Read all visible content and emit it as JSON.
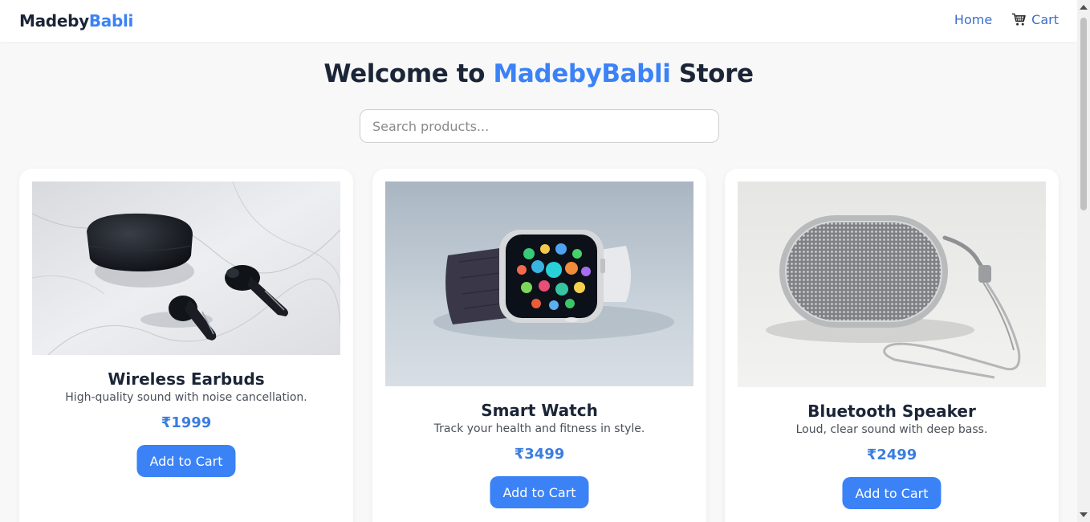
{
  "nav": {
    "logo_main": "Madeby",
    "logo_accent": "Babli",
    "home_label": "Home",
    "cart_label": "Cart"
  },
  "hero": {
    "title_start": "Welcome to ",
    "title_accent": "MadebyBabli",
    "title_end": " Store"
  },
  "search": {
    "placeholder": "Search products...",
    "value": ""
  },
  "products": [
    {
      "name": "Wireless Earbuds",
      "description": "High-quality sound with noise cancellation.",
      "price": "₹1999",
      "button": "Add to Cart",
      "image_icon": "earbuds-image"
    },
    {
      "name": "Smart Watch",
      "description": "Track your health and fitness in style.",
      "price": "₹3499",
      "button": "Add to Cart",
      "image_icon": "smart-watch-image"
    },
    {
      "name": "Bluetooth Speaker",
      "description": "Loud, clear sound with deep bass.",
      "price": "₹2499",
      "button": "Add to Cart",
      "image_icon": "bluetooth-speaker-image"
    }
  ],
  "colors": {
    "accent": "#3b82f6",
    "text_dark": "#1b2537",
    "background": "#f8f8f8",
    "price": "#3b7de0"
  }
}
